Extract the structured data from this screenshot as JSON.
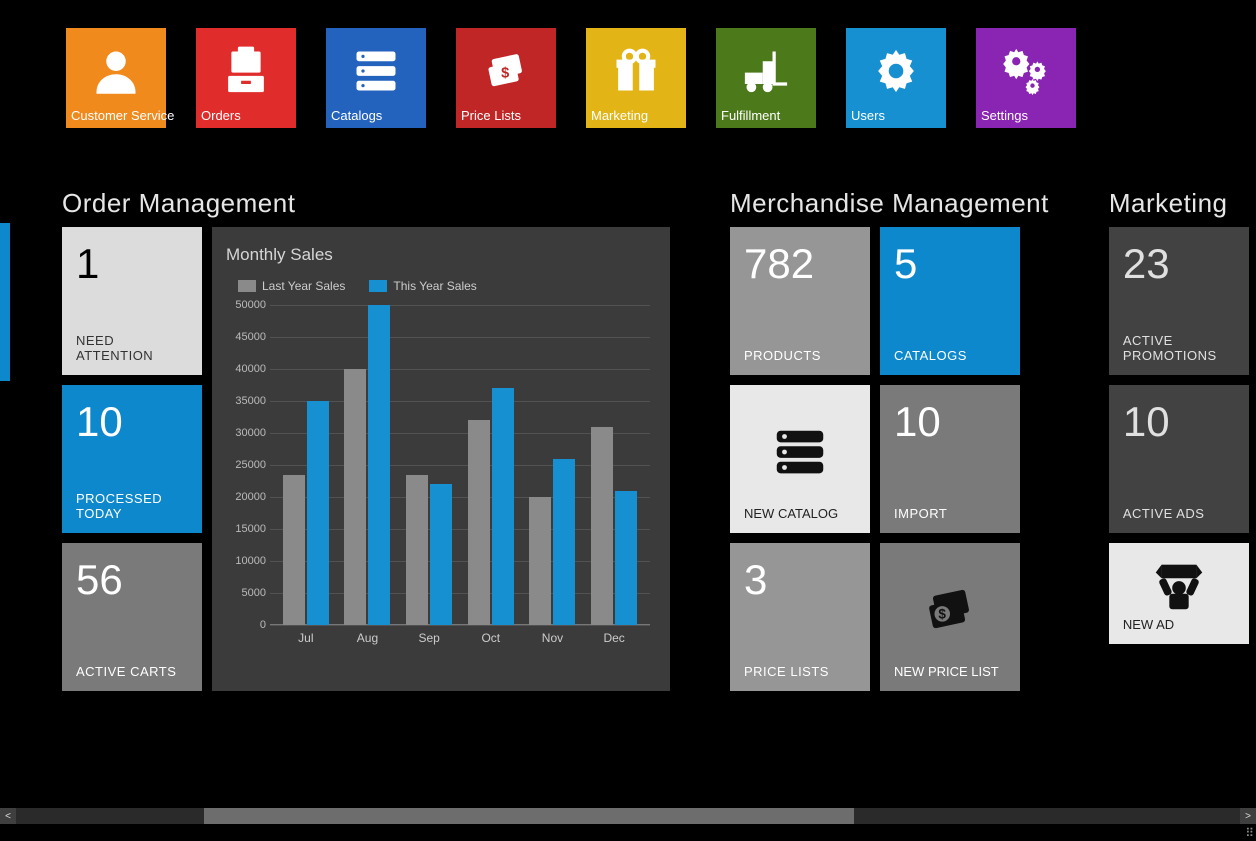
{
  "nav": [
    {
      "label": "Customer Service",
      "color": "#f08a1d",
      "icon": "user"
    },
    {
      "label": "Orders",
      "color": "#e12c2c",
      "icon": "file-cabinet"
    },
    {
      "label": "Catalogs",
      "color": "#2362bd",
      "icon": "server"
    },
    {
      "label": "Price Lists",
      "color": "#c02626",
      "icon": "price-tags"
    },
    {
      "label": "Marketing",
      "color": "#e3b416",
      "icon": "gift"
    },
    {
      "label": "Fulfillment",
      "color": "#4c7a1a",
      "icon": "forklift"
    },
    {
      "label": "Users",
      "color": "#1690d0",
      "icon": "gear"
    },
    {
      "label": "Settings",
      "color": "#8a24b3",
      "icon": "gears"
    }
  ],
  "sections": {
    "order": {
      "title": "Order Management",
      "tiles": [
        {
          "value": "1",
          "caption": "NEED ATTENTION"
        },
        {
          "value": "10",
          "caption": "PROCESSED TODAY"
        },
        {
          "value": "56",
          "caption": "ACTIVE CARTS"
        }
      ]
    },
    "chart": {
      "title": "Monthly Sales",
      "legend": [
        "Last Year Sales",
        "This Year Sales"
      ]
    },
    "merch": {
      "title": "Merchandise Management",
      "tiles": [
        {
          "value": "782",
          "caption": "PRODUCTS"
        },
        {
          "value": "5",
          "caption": "CATALOGS"
        },
        {
          "caption": "NEW CATALOG"
        },
        {
          "value": "10",
          "caption": "IMPORT"
        },
        {
          "value": "3",
          "caption": "PRICE LISTS"
        },
        {
          "caption": "NEW PRICE LIST"
        }
      ]
    },
    "mkt": {
      "title": "Marketing",
      "tiles": [
        {
          "value": "23",
          "caption": "ACTIVE PROMOTIONS"
        },
        {
          "value": "10",
          "caption": "ACTIVE ADS"
        },
        {
          "caption": "NEW AD"
        }
      ]
    }
  },
  "chart_data": {
    "type": "bar",
    "title": "Monthly Sales",
    "categories": [
      "Jul",
      "Aug",
      "Sep",
      "Oct",
      "Nov",
      "Dec"
    ],
    "series": [
      {
        "name": "Last Year Sales",
        "values": [
          23500,
          40000,
          23500,
          32000,
          20000,
          31000
        ]
      },
      {
        "name": "This Year Sales",
        "values": [
          35000,
          50000,
          22000,
          37000,
          26000,
          21000
        ]
      }
    ],
    "ylim": [
      0,
      50000
    ],
    "ystep": 5000,
    "xlabel": "",
    "ylabel": ""
  }
}
